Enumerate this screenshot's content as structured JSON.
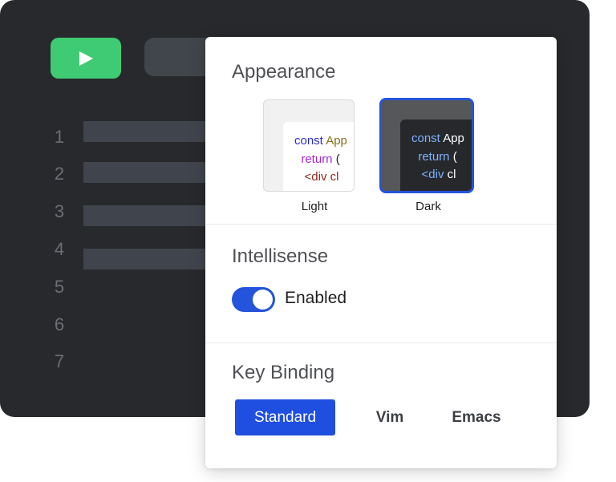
{
  "editor": {
    "line_numbers": [
      "1",
      "2",
      "3",
      "4",
      "5",
      "6",
      "7"
    ],
    "run_icon": "play-icon"
  },
  "settings": {
    "appearance": {
      "title": "Appearance",
      "themes": [
        {
          "label": "Light",
          "selected": false,
          "code": [
            "const",
            "App",
            "return",
            "(",
            "<div",
            "cl"
          ]
        },
        {
          "label": "Dark",
          "selected": true,
          "code": [
            "const",
            "App",
            "return",
            "(",
            "<div",
            "cl"
          ]
        }
      ]
    },
    "intellisense": {
      "title": "Intellisense",
      "toggle_label": "Enabled",
      "enabled": true
    },
    "key_binding": {
      "title": "Key Binding",
      "options": [
        "Standard",
        "Vim",
        "Emacs"
      ],
      "selected": "Standard"
    }
  },
  "colors": {
    "accent": "#1f4fe0",
    "run_green": "#3ecb73",
    "editor_bg": "#28292c"
  }
}
